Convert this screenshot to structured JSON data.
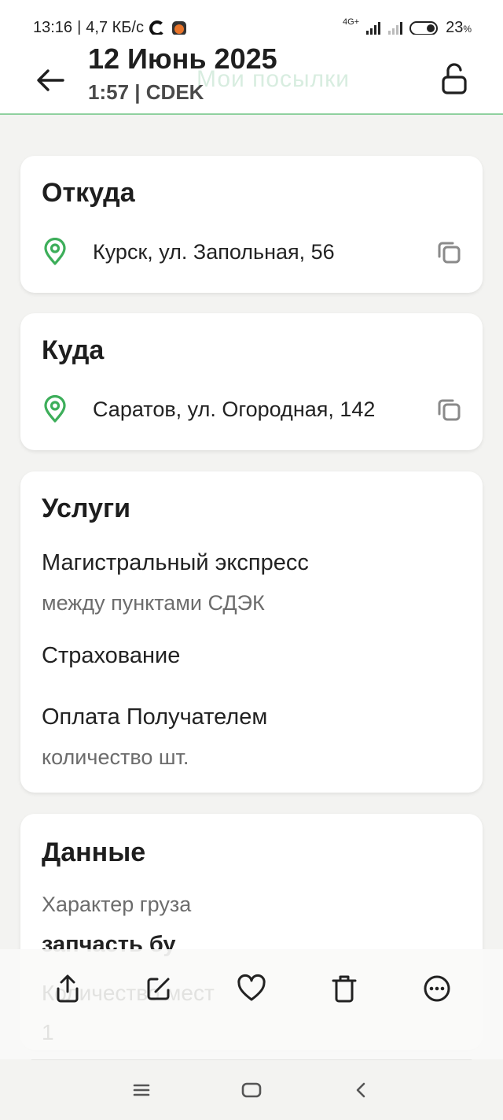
{
  "status_bar": {
    "time": "13:16",
    "separator": "|",
    "speed": "4,7 КБ/с",
    "network": "4G+",
    "battery": "23",
    "battery_unit": "%"
  },
  "header": {
    "title": "12 Июнь 2025",
    "subtitle": "1:57 | CDEK",
    "background_title": "Мои посылки"
  },
  "from_card": {
    "title": "Откуда",
    "address": "Курск, ул. Запольная, 56"
  },
  "to_card": {
    "title": "Куда",
    "address": "Саратов, ул. Огородная, 142"
  },
  "services": {
    "title": "Услуги",
    "items": [
      {
        "name": "Магистральный экспресс",
        "detail": "между пунктами СДЭК"
      },
      {
        "name": "Страхование",
        "detail": ""
      },
      {
        "name": "Оплата Получателем",
        "detail": "количество шт."
      }
    ]
  },
  "data_card": {
    "title": "Данные",
    "cargo_label": "Характер груза",
    "cargo_value": "запчасть бу",
    "places_label": "Количество мест",
    "places_value": "1"
  },
  "actions": [
    "share-icon",
    "edit-icon",
    "heart-icon",
    "trash-icon",
    "more-icon"
  ],
  "colors": {
    "accent": "#3dae5a",
    "header_border": "#8fd09f",
    "page_bg": "#f3f3f1"
  }
}
